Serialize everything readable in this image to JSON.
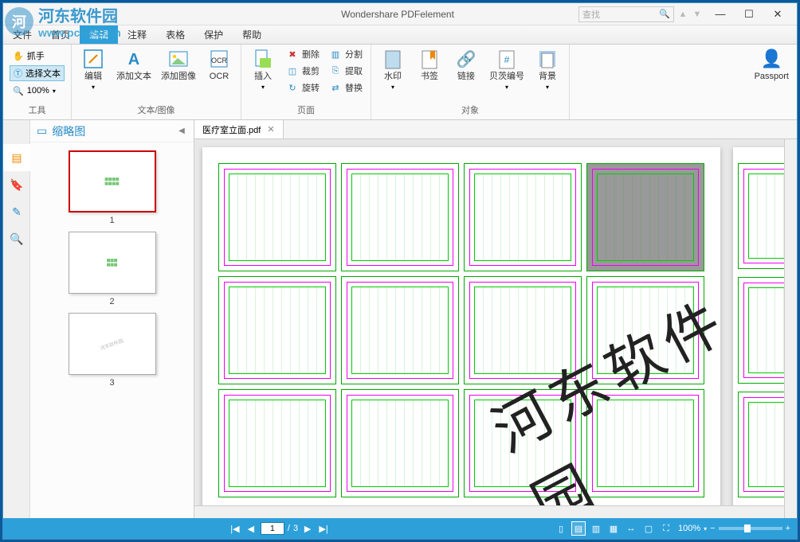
{
  "window": {
    "title": "Wondershare PDFelement"
  },
  "search": {
    "placeholder": "查找"
  },
  "menus": [
    "文件",
    "首页",
    "编辑",
    "注释",
    "表格",
    "保护",
    "帮助"
  ],
  "active_menu_index": 2,
  "ribbon": {
    "tools_group_label": "工具",
    "tools": {
      "hand": "抓手",
      "select": "选择文本",
      "zoom": "100%"
    },
    "textimage_group_label": "文本/图像",
    "textimage": {
      "edit": "编辑",
      "addtext": "添加文本",
      "addimage": "添加图像",
      "ocr": "OCR"
    },
    "page_group_label": "页面",
    "page": {
      "insert": "插入",
      "delete": "删除",
      "crop": "裁剪",
      "rotate": "旋转",
      "split": "分割",
      "extract": "提取",
      "replace": "替换"
    },
    "object_group_label": "对象",
    "object": {
      "watermark": "水印",
      "bookmark": "书签",
      "link": "链接",
      "bates": "贝茨编号",
      "background": "背景"
    },
    "passport": "Passport"
  },
  "sidebar": {
    "title": "缩略图",
    "thumbs": [
      "1",
      "2",
      "3"
    ],
    "selected": 0
  },
  "doc": {
    "tab_name": "医疗室立面.pdf"
  },
  "watermark_text": "河东软件园",
  "status": {
    "current_page": "1",
    "total_pages": "3",
    "separator": "/",
    "zoom": "100%"
  },
  "overlay": {
    "site_name": "河东软件园",
    "url": "www.pc0359.cn"
  }
}
